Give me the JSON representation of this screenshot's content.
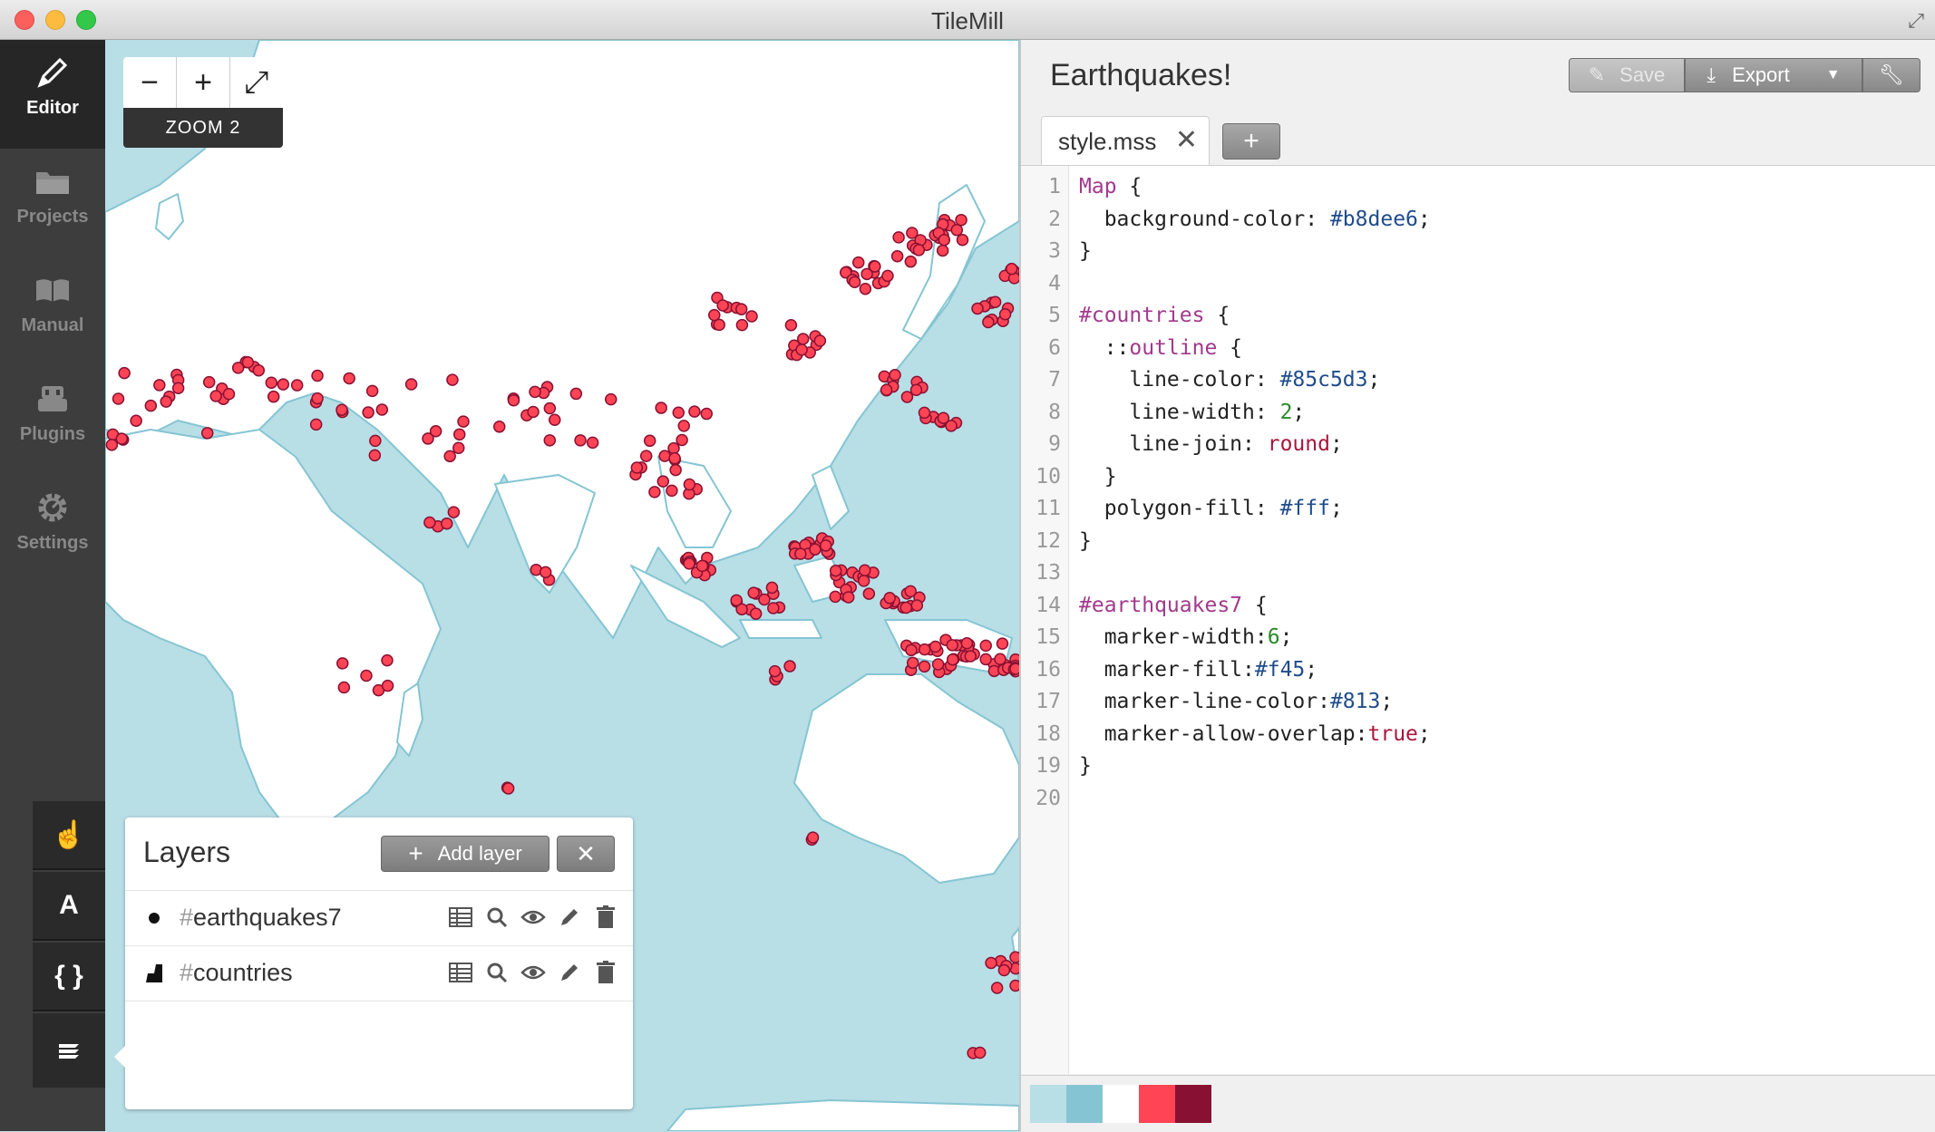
{
  "window": {
    "title": "TileMill"
  },
  "sidebar": {
    "items": [
      {
        "label": "Editor",
        "icon": "pencil-icon",
        "active": true
      },
      {
        "label": "Projects",
        "icon": "folder-icon",
        "active": false
      },
      {
        "label": "Manual",
        "icon": "book-icon",
        "active": false
      },
      {
        "label": "Plugins",
        "icon": "plugin-icon",
        "active": false
      },
      {
        "label": "Settings",
        "icon": "gear-icon",
        "active": false
      }
    ],
    "tools": [
      {
        "label": "",
        "icon": "hand-icon"
      },
      {
        "label": "A",
        "icon": "font-icon"
      },
      {
        "label": "{ }",
        "icon": "braces-icon"
      },
      {
        "label": "",
        "icon": "layers-icon"
      }
    ]
  },
  "map": {
    "zoom_out": "−",
    "zoom_in": "+",
    "fullscreen": "⤢",
    "zoom_label": "ZOOM 2",
    "background_color": "#b8dee6",
    "land_color": "#ffffff",
    "border_color": "#85c5d3",
    "marker_fill": "#ff4455",
    "marker_line": "#881133"
  },
  "layers": {
    "title": "Layers",
    "add_label": "Add layer",
    "close_label": "✕",
    "items": [
      {
        "hash": "#",
        "name": "earthquakes7",
        "type": "point"
      },
      {
        "hash": "#",
        "name": "countries",
        "type": "polygon"
      }
    ]
  },
  "editor": {
    "project_title": "Earthquakes!",
    "save_label": "Save",
    "export_label": "Export",
    "tab_name": "style.mss",
    "tab_close": "✕",
    "tab_add": "+",
    "line_numbers": [
      "1",
      "2",
      "3",
      "4",
      "5",
      "6",
      "7",
      "8",
      "9",
      "10",
      "11",
      "12",
      "13",
      "14",
      "15",
      "16",
      "17",
      "18",
      "19",
      "20"
    ],
    "code": [
      [
        [
          "k",
          "Map"
        ],
        [
          "p",
          " {"
        ]
      ],
      [
        [
          "p",
          "  background-color: "
        ],
        [
          "c",
          "#b8dee6"
        ],
        [
          "p",
          ";"
        ]
      ],
      [
        [
          "p",
          "}"
        ]
      ],
      [
        [
          "p",
          ""
        ]
      ],
      [
        [
          "k",
          "#countries"
        ],
        [
          "p",
          " {"
        ]
      ],
      [
        [
          "p",
          "  ::"
        ],
        [
          "k",
          "outline"
        ],
        [
          "p",
          " {"
        ]
      ],
      [
        [
          "p",
          "    line-color: "
        ],
        [
          "c",
          "#85c5d3"
        ],
        [
          "p",
          ";"
        ]
      ],
      [
        [
          "p",
          "    line-width: "
        ],
        [
          "n",
          "2"
        ],
        [
          "p",
          ";"
        ]
      ],
      [
        [
          "p",
          "    line-join: "
        ],
        [
          "v",
          "round"
        ],
        [
          "p",
          ";"
        ]
      ],
      [
        [
          "p",
          "  }"
        ]
      ],
      [
        [
          "p",
          "  polygon-fill: "
        ],
        [
          "c",
          "#fff"
        ],
        [
          "p",
          ";"
        ]
      ],
      [
        [
          "p",
          "}"
        ]
      ],
      [
        [
          "p",
          ""
        ]
      ],
      [
        [
          "k",
          "#earthquakes7"
        ],
        [
          "p",
          " {"
        ]
      ],
      [
        [
          "p",
          "  marker-width:"
        ],
        [
          "n",
          "6"
        ],
        [
          "p",
          ";"
        ]
      ],
      [
        [
          "p",
          "  marker-fill:"
        ],
        [
          "c",
          "#f45"
        ],
        [
          "p",
          ";"
        ]
      ],
      [
        [
          "p",
          "  marker-line-color:"
        ],
        [
          "c",
          "#813"
        ],
        [
          "p",
          ";"
        ]
      ],
      [
        [
          "p",
          "  marker-allow-overlap:"
        ],
        [
          "v",
          "true"
        ],
        [
          "p",
          ";"
        ]
      ],
      [
        [
          "p",
          "}"
        ]
      ],
      [
        [
          "p",
          ""
        ]
      ]
    ],
    "palette": [
      "#b8dee6",
      "#85c5d3",
      "#ffffff",
      "#ff4455",
      "#881133"
    ]
  }
}
